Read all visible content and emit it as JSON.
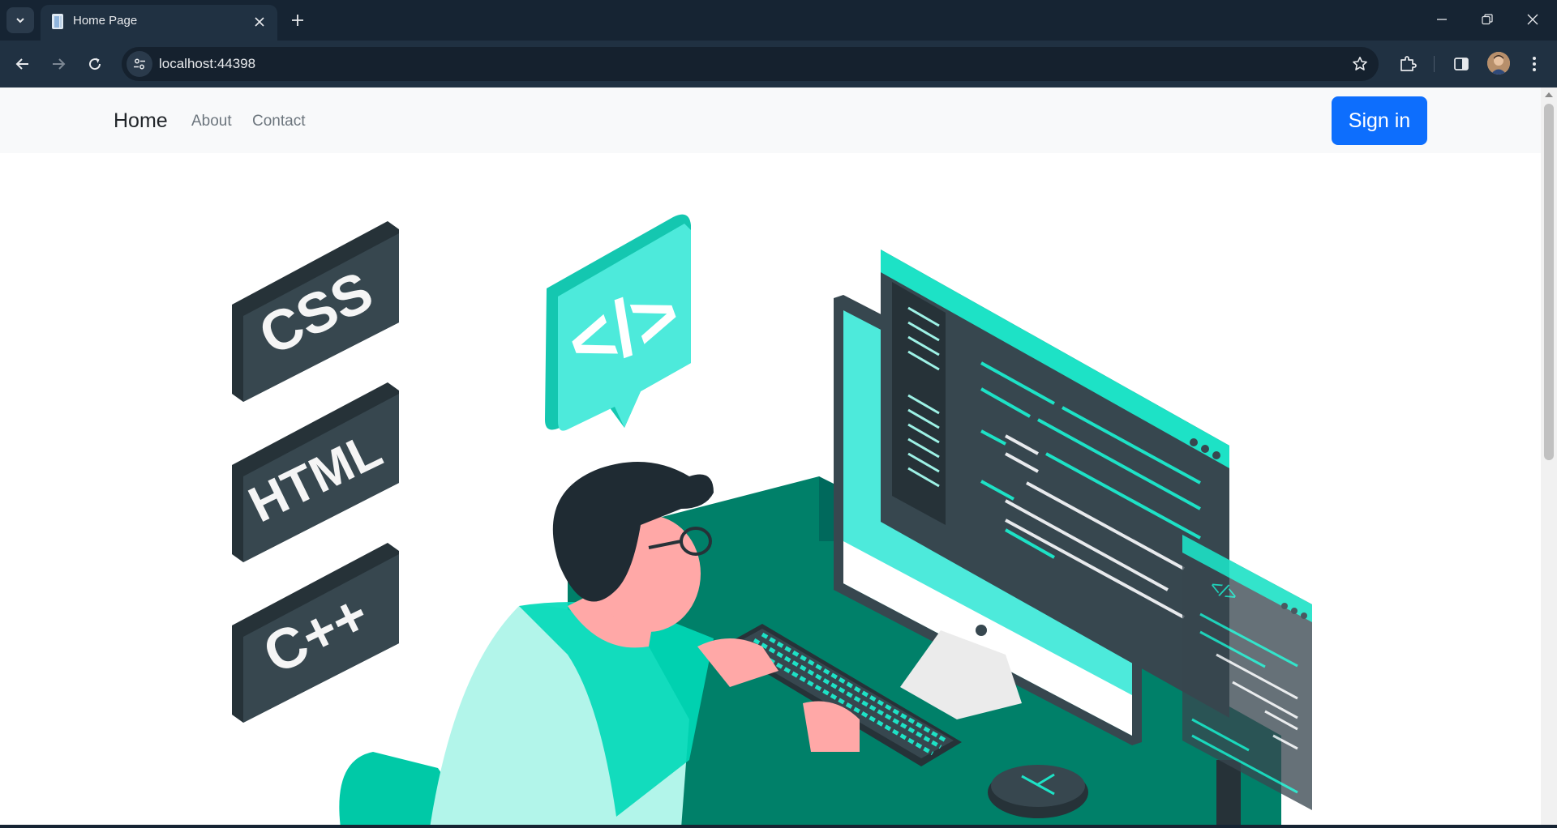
{
  "browser": {
    "tab_title": "Home Page",
    "url": "localhost:44398",
    "icons": {
      "tab_list": "chevron-down-icon",
      "favicon": "page-icon",
      "close_tab": "close-icon",
      "new_tab": "plus-icon",
      "back": "arrow-left-icon",
      "forward": "arrow-right-icon",
      "reload": "reload-icon",
      "site_info": "tune-icon",
      "bookmark": "star-icon",
      "extensions": "puzzle-icon",
      "side_panel": "side-panel-icon",
      "profile": "avatar",
      "menu": "kebab-menu-icon",
      "minimize": "minimize-icon",
      "restore": "restore-icon",
      "close_window": "close-icon"
    }
  },
  "navbar": {
    "brand": "Home",
    "links": [
      {
        "label": "About"
      },
      {
        "label": "Contact"
      }
    ],
    "signin_label": "Sign in",
    "signin_color": "#0d6efd"
  },
  "hero": {
    "tiles": [
      {
        "label": "CSS"
      },
      {
        "label": "HTML"
      },
      {
        "label": "C++"
      }
    ],
    "bubble_label": "</>",
    "window_label": "</>",
    "colors": {
      "accent": "#1de2c6",
      "dark": "#37474f",
      "desk": "#008069",
      "skin": "#ffa8a7",
      "hair": "#1f2b33"
    }
  }
}
